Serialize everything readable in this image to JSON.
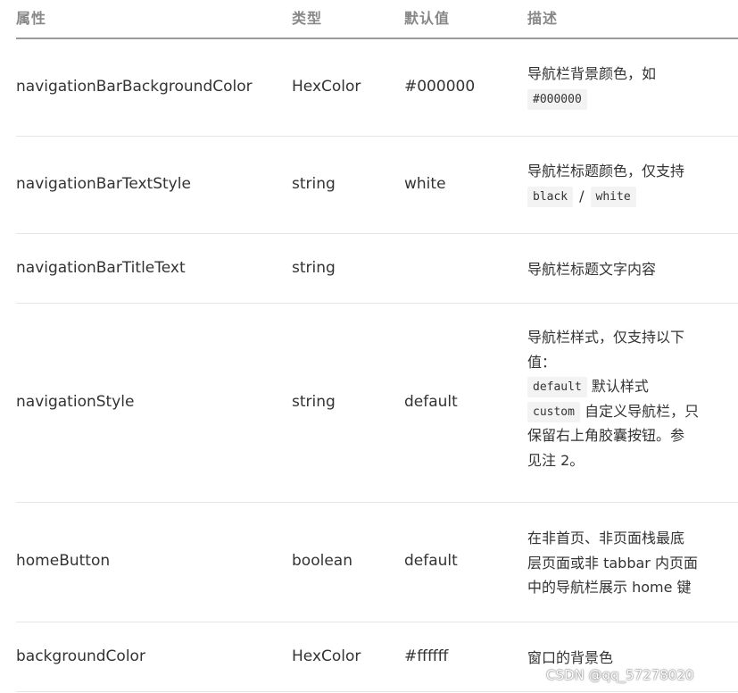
{
  "headers": {
    "property": "属性",
    "type": "类型",
    "default": "默认值",
    "description": "描述"
  },
  "rows": [
    {
      "property": "navigationBarBackgroundColor",
      "type": "HexColor",
      "default": "#000000",
      "desc_text": "导航栏背景颜色，如",
      "desc_code": "#000000"
    },
    {
      "property": "navigationBarTextStyle",
      "type": "string",
      "default": "white",
      "desc_text": "导航栏标题颜色，仅支持",
      "code_a": "black",
      "separator": "/",
      "code_b": "white"
    },
    {
      "property": "navigationBarTitleText",
      "type": "string",
      "default": "",
      "desc_text": "导航栏标题文字内容"
    },
    {
      "property": "navigationStyle",
      "type": "string",
      "default": "default",
      "desc_line1": "导航栏样式，仅支持以下",
      "desc_line2": "值：",
      "code_default": "default",
      "code_default_text": "默认样式",
      "code_custom": "custom",
      "code_custom_text": "自定义导航栏，只",
      "desc_line5": "保留右上角胶囊按钮。参",
      "desc_line6": "见注 2。"
    },
    {
      "property": "homeButton",
      "type": "boolean",
      "default": "default",
      "desc_line1": "在非首页、非页面栈最底",
      "desc_line2": "层页面或非 tabbar 内页面",
      "desc_line3": "中的导航栏展示 home 键"
    },
    {
      "property": "backgroundColor",
      "type": "HexColor",
      "default": "#ffffff",
      "desc_text": "窗口的背景色"
    }
  ],
  "watermark": "CSDN @qq_57278020"
}
